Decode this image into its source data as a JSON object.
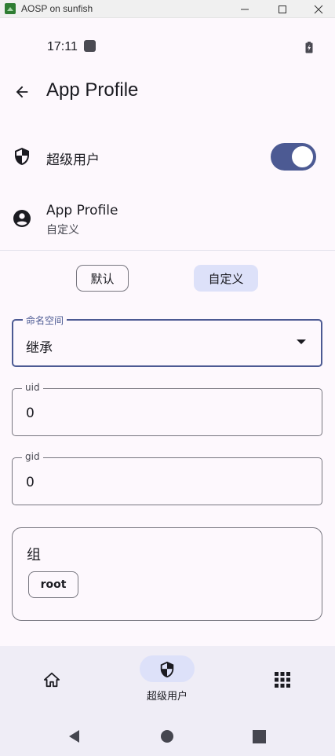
{
  "window": {
    "title": "AOSP on sunfish"
  },
  "status_bar": {
    "time": "17:11"
  },
  "app_bar": {
    "title": "App Profile"
  },
  "superuser": {
    "label": "超级用户",
    "enabled": true
  },
  "app_profile": {
    "title": "App Profile",
    "subtitle": "自定义"
  },
  "segments": {
    "default_label": "默认",
    "custom_label": "自定义",
    "selected": "自定义"
  },
  "namespace": {
    "label": "命名空间",
    "value": "继承"
  },
  "uid": {
    "label": "uid",
    "value": "0"
  },
  "gid": {
    "label": "gid",
    "value": "0"
  },
  "groups": {
    "title": "组",
    "chips": [
      "root"
    ]
  },
  "bottom_nav": {
    "superuser_label": "超级用户",
    "selected": "superuser"
  },
  "colors": {
    "accent": "#4c5a93",
    "selected_bg": "#dde1f9",
    "background": "#fdf8fd",
    "nav_bg": "#efedf6"
  }
}
